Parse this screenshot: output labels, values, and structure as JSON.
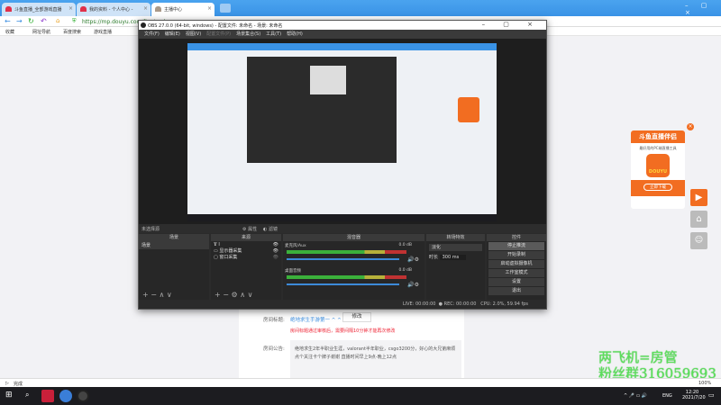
{
  "browser": {
    "tabs": [
      "斗鱼直播_全部游戏直播",
      "我的资料 - 个人中心 -",
      "主播中心"
    ],
    "url": "https://mp.douyu.com/live/main",
    "bookmarks": [
      "收藏",
      "网址导航",
      "百度搜索",
      "游戏直播"
    ],
    "status": "完成",
    "zoom": "100%"
  },
  "obs": {
    "title": "OBS 27.0.0 (64-bit, windows) - 配置文件: 未命名 - 场景: 未命名",
    "menu": [
      "文件(F)",
      "编辑(E)",
      "视图(V)",
      "配置文件(P)",
      "场景集合(S)",
      "工具(T)",
      "帮助(H)"
    ],
    "toolbar": {
      "no_source": "未选择源",
      "properties": "属性",
      "filters": "滤镜"
    },
    "docks": {
      "scenes": "场景",
      "sources": "来源",
      "mixer": "混音器",
      "transitions": "转场特效",
      "controls": "控件"
    },
    "scenes": [
      "场景"
    ],
    "sources": [
      "I",
      "显示器采集",
      "窗口采集"
    ],
    "mixer": [
      {
        "name": "麦克风/Aux",
        "db": "0.0 dB"
      },
      {
        "name": "桌面音频",
        "db": "0.0 dB"
      }
    ],
    "transition": {
      "type": "淡化",
      "duration_label": "时长",
      "duration": "300 ms"
    },
    "controls": [
      "停止推流",
      "开始录制",
      "启动虚拟摄像机",
      "工作室模式",
      "设置",
      "退出"
    ],
    "statusbar": {
      "live": "LIVE: 00:00:00",
      "rec": "REC: 00:00:00",
      "cpu": "CPU: 2.0%, 59.94 fps"
    }
  },
  "room": {
    "title_label": "房间标题:",
    "title_value": "绝地求生手游第一 ^ ^",
    "edit": "修改",
    "warning": "房间标题通过审核后，需要间隔10分钟才能再次修改",
    "notice_label": "房间公告:",
    "notice": "绝地求生2年半职业生涯，valorant半年职业，csgo3200分，好心的大兄弟麻烦点个关注卡个牌子谢谢 直播时间早上9点-晚上12点"
  },
  "ad": {
    "title": "斗鱼直播伴侣",
    "subtitle": "最好用的PC端直播工具",
    "logo": "DOUYU",
    "button": "立即下载"
  },
  "watermark": [
    "两飞机=房管",
    "粉丝群316059693"
  ],
  "taskbar": {
    "lang": "ENG",
    "time": "12:20",
    "date": "2021/7/20"
  },
  "colors": {
    "accent": "#f26d21",
    "live_green": "#5ae05a"
  }
}
